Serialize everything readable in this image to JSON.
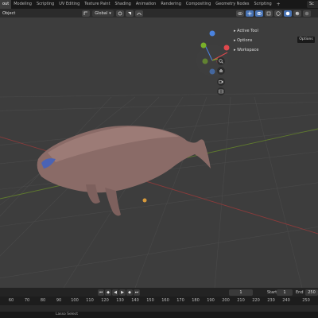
{
  "topbar": {
    "tabs": [
      {
        "label": "out",
        "active": true
      },
      {
        "label": "Modeling"
      },
      {
        "label": "Scripting"
      },
      {
        "label": "UV Editing"
      },
      {
        "label": "Texture Paint"
      },
      {
        "label": "Shading"
      },
      {
        "label": "Animation"
      },
      {
        "label": "Rendering"
      },
      {
        "label": "Compositing"
      },
      {
        "label": "Geometry Nodes"
      },
      {
        "label": "Scripting"
      }
    ],
    "add_label": "+",
    "scene_label": "Sc"
  },
  "viewport_header": {
    "object_menu": "Object",
    "transform_orientation": "Global",
    "options_tooltip": "Options"
  },
  "sidebar_panels": [
    "Active Tool",
    "Options",
    "Workspace"
  ],
  "gizmo": {
    "x_color": "#e0484d",
    "y_color": "#79b02a",
    "z_color": "#4a83e0"
  },
  "timeline": {
    "current_frame": "1",
    "start_label": "Start",
    "start_value": "1",
    "end_label": "End",
    "end_value": "250",
    "ticks": [
      "60",
      "70",
      "80",
      "90",
      "100",
      "110",
      "120",
      "130",
      "140",
      "150",
      "160",
      "170",
      "180",
      "190",
      "200",
      "210",
      "220",
      "230",
      "240",
      "250"
    ]
  },
  "status": {
    "hint": "Lasso Select"
  }
}
